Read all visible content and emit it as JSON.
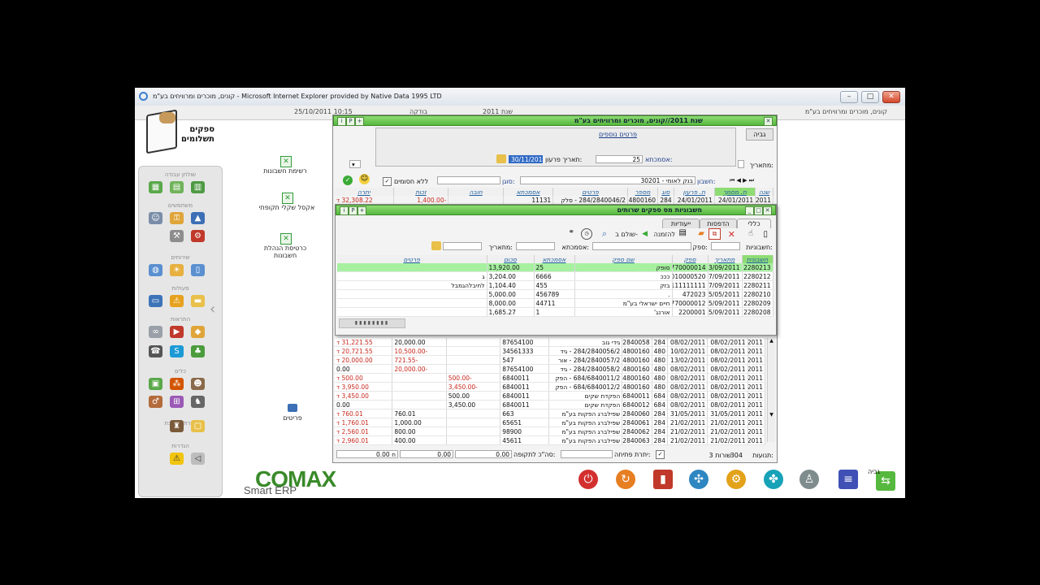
{
  "browser": {
    "title": "קונים, מוכרים ומרוויחים בע\"מ - Microsoft Internet Explorer provided by Native Data 1995 LTD"
  },
  "header": {
    "company": "קונים, מוכרים ומרוויחים בע\"מ",
    "year": "שנת 2011",
    "status": "בודקה",
    "datetime": "25/10/2011 10:15"
  },
  "left_panel": {
    "title_line1": "ספקים",
    "title_line2": "תשלומים",
    "groups": [
      "שולחן עבודה",
      "משתמשים",
      "שירותים",
      "פעולות",
      "התראות",
      "כלים",
      "עזרת מערכת",
      "הגדרות"
    ]
  },
  "shortcuts": [
    {
      "label": "רשימת חשבונות"
    },
    {
      "label": "אקסל שקלי תקופתי"
    },
    {
      "label": "כרטיסת הנהלת חשבונות"
    },
    {
      "label": "פריטים"
    }
  ],
  "back_window": {
    "title": "שנת 2011//קונים, מוכרים ומרוויחים בע\"מ",
    "tab_label": "גביה",
    "extra_details_link": "פרטים נוספים",
    "reference_label": "אסמכתא:",
    "reference_value": "25",
    "repay_date_label": "תאריך פרעון:",
    "repay_date_value": "30/11/2011",
    "date_from_label": "מתאריך:",
    "account_label": "חשבון:",
    "account_value": "30201 - בנק לאומי",
    "code_label": "סוגן:",
    "no_signatures_label": "ללא חסומים",
    "columns": [
      "שנה",
      "ת. מסמך",
      "ת. פרעון",
      "סוג",
      "מספר",
      "פרטים",
      "אסמכתא",
      "חובה",
      "זכות",
      "יתרה"
    ],
    "top_row": [
      "2011",
      "24/01/2011",
      "24/01/2011",
      "284",
      "4800160",
      "284/2840046/2 - סלק",
      "11131",
      "",
      "-1,400.00",
      "32,308.22 ד"
    ],
    "rows": [
      [
        "2011",
        "08/02/2011",
        "08/02/2011",
        "284",
        "2840058",
        "גידי גוב",
        "87654100",
        "",
        "20,000.00",
        "31,221.55 ד"
      ],
      [
        "2011",
        "08/02/2011",
        "10/02/2011",
        "480",
        "4800160",
        "284/2840056/2 - גיד",
        "34561333",
        "",
        "-10,500.00",
        "20,721.55 ד"
      ],
      [
        "2011",
        "08/02/2011",
        "13/02/2011",
        "480",
        "4800160",
        "284/2840057/2 - אור",
        "547",
        "",
        "-721.55",
        "20,000.00 ד"
      ],
      [
        "2011",
        "08/02/2011",
        "08/02/2011",
        "480",
        "4800160",
        "284/2840058/2 - גיד",
        "87654100",
        "",
        "-20,000.00",
        "0.00"
      ],
      [
        "2011",
        "08/02/2011",
        "08/02/2011",
        "480",
        "4800160",
        "684/6840011/2 - הפק",
        "6840011",
        "-500.00",
        "",
        "500.00 ד"
      ],
      [
        "2011",
        "08/02/2011",
        "08/02/2011",
        "480",
        "4800160",
        "684/6840012/2 - הפק",
        "6840011",
        "-3,450.00",
        "",
        "3,950.00 ד"
      ],
      [
        "2011",
        "08/02/2011",
        "08/02/2011",
        "684",
        "6840011",
        "הפקדת שקים",
        "6840011",
        "500.00",
        "",
        "3,450.00 ד"
      ],
      [
        "2011",
        "08/02/2011",
        "08/02/2011",
        "684",
        "6840012",
        "הפקדת שקים",
        "6840011",
        "3,450.00",
        "",
        "0.00"
      ],
      [
        "2011",
        "31/05/2011",
        "31/05/2011",
        "284",
        "2840060",
        "שפילברג הפקות בע\"מ",
        "663",
        "",
        "760.01",
        "760.01 ד"
      ],
      [
        "2011",
        "21/02/2011",
        "21/02/2011",
        "284",
        "2840061",
        "שפילברג הפקות בע\"מ",
        "65651",
        "",
        "1,000.00",
        "1,760.01 ד"
      ],
      [
        "2011",
        "21/02/2011",
        "21/02/2011",
        "284",
        "2840062",
        "שפילברג הפקות בע\"מ",
        "98900",
        "",
        "800.00",
        "2,560.01 ד"
      ],
      [
        "2011",
        "21/02/2011",
        "21/02/2011",
        "284",
        "2840063",
        "שפילברג הפקות בע\"מ",
        "45611",
        "",
        "400.00",
        "2,960.01 ד"
      ]
    ],
    "footer": {
      "records_label": "תנועות:",
      "records_value": "304",
      "rows_label": "3 שורות",
      "open_balance_label": "יתרת פתיחה:",
      "period_total_label": "סה\"כ לתקופה:",
      "total1": "0.00",
      "total2": "0.00",
      "total3": "0.00 ח"
    }
  },
  "front_window": {
    "title": "חשבוניות מס ספקים שרותים",
    "tabs": [
      "כללי",
      "הדפסות",
      "ייעודיות"
    ],
    "toolbar": {
      "invite_label": "להזמנה",
      "pay_label": "שולם ב-"
    },
    "filters": {
      "invoices_label": "חשבוניות:",
      "supplier_label": "ספק:",
      "reference_label": "אסמכתא:",
      "date_from_label": "מתאריך:"
    },
    "columns": [
      "חשבונית",
      "מתאריך",
      "ספק",
      "שם ספק",
      "אסמכתא",
      "סכום",
      "פרטים"
    ],
    "rows": [
      [
        "2280213",
        "23/09/2011",
        "2770000014",
        "סופק",
        "25",
        "13,920.00",
        ""
      ],
      [
        "2280212",
        "07/09/2011",
        "1010000520",
        "כככ",
        "6666",
        "3,204.00",
        "ג"
      ],
      [
        "2280211",
        "07/09/2011",
        "1111111111",
        "בזק",
        "455",
        "1,104.40",
        "לחיבלהגמבל"
      ],
      [
        "2280210",
        "15/05/2011",
        "472023",
        ".",
        "456789",
        "5,000.00",
        ""
      ],
      [
        "2280209",
        "05/09/2011",
        "2770000012",
        "חיים ישראלי בע\"מ",
        "44711",
        "8,000.00",
        ""
      ],
      [
        "2280208",
        "05/09/2011",
        "2200001",
        "אורנג'",
        "1",
        "1,685.27",
        ""
      ]
    ]
  },
  "bottom_bar": {
    "brand": "COMAX",
    "brand_sub": "Smart ERP",
    "collect_label": "גביה"
  },
  "colors": {
    "accent_green": "#56b83e",
    "selected_row": "#a6f0a0",
    "negative": "#c8281e"
  }
}
